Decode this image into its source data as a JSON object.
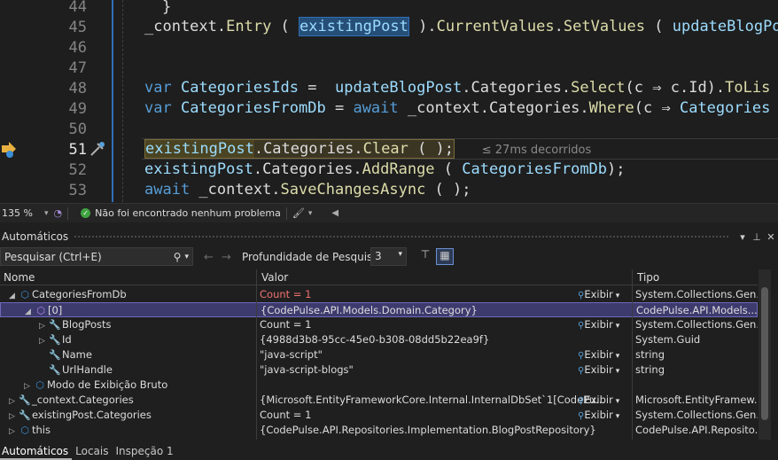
{
  "editor": {
    "lines": [
      {
        "num": "44",
        "text": "}"
      },
      {
        "num": "45",
        "parts": [
          "_context.",
          "Entry",
          " ( ",
          "existingPost",
          " ).",
          "CurrentValues",
          ".",
          "SetValues",
          " ( ",
          "updateBlogPo"
        ]
      },
      {
        "num": "46"
      },
      {
        "num": "47"
      },
      {
        "num": "48",
        "parts": [
          "var",
          " ",
          "CategoriesIds",
          " =  ",
          "updateBlogPost",
          ".Categories.",
          "Select",
          "(c ",
          "⇒",
          " c.Id).",
          "ToLis"
        ]
      },
      {
        "num": "49",
        "parts": [
          "var",
          " ",
          "CategoriesFromDb",
          " = ",
          "await",
          " _context.Categories.",
          "Where",
          "(c ",
          "⇒",
          " Categories"
        ]
      },
      {
        "num": "50"
      },
      {
        "num": "51",
        "parts": [
          "existingPost",
          ".Categories.",
          "Clear",
          " ( );"
        ],
        "elapsed": "≤ 27ms decorridos"
      },
      {
        "num": "52",
        "parts": [
          "existingPost",
          ".Categories.",
          "AddRange",
          " ( ",
          "CategoriesFromDb",
          ");"
        ]
      },
      {
        "num": "53",
        "parts": [
          "await",
          " _context.",
          "SaveChangesAsync",
          " ( );"
        ]
      }
    ]
  },
  "editor_status": {
    "zoom": "135 %",
    "message": "Não foi encontrado nenhum problema"
  },
  "panel": {
    "title": "Automáticos",
    "search_placeholder": "Pesquisar (Ctrl+E)",
    "depth_label": "Profundidade de Pesquisa:",
    "depth_value": "3",
    "columns": {
      "name": "Nome",
      "value": "Valor",
      "type": "Tipo"
    },
    "view_label": "Exibir",
    "rows": [
      {
        "name": "CategoriesFromDb",
        "value": "Count = 1",
        "type": "System.Collections.Gen...",
        "indent": 0,
        "expander": "◢",
        "icon": "cube",
        "changed": true,
        "viewer": true
      },
      {
        "name": "[0]",
        "value": "{CodePulse.API.Models.Domain.Category}",
        "type": "CodePulse.API.Models....",
        "indent": 1,
        "expander": "◢",
        "icon": "cubep",
        "selected": true,
        "viewer": false
      },
      {
        "name": "BlogPosts",
        "value": "Count = 1",
        "type": "System.Collections.Gen...",
        "indent": 2,
        "expander": "▷",
        "icon": "wrench",
        "viewer": true
      },
      {
        "name": "Id",
        "value": "{4988d3b8-95cc-45e0-b308-08dd5b22ea9f}",
        "type": "System.Guid",
        "indent": 2,
        "expander": "▷",
        "icon": "wrench",
        "viewer": false
      },
      {
        "name": "Name",
        "value": "\"java-script\"",
        "type": "string",
        "indent": 2,
        "expander": "",
        "icon": "wrench",
        "viewer": true
      },
      {
        "name": "UrlHandle",
        "value": "\"java-script-blogs\"",
        "type": "string",
        "indent": 2,
        "expander": "",
        "icon": "wrench",
        "viewer": true
      },
      {
        "name": "Modo de Exibição Bruto",
        "value": "",
        "type": "",
        "indent": 1,
        "expander": "▷",
        "icon": "cube",
        "viewer": false
      },
      {
        "name": "_context.Categories",
        "value": "{Microsoft.EntityFrameworkCore.Internal.InternalDbSet`1[CodePu...",
        "type": "Microsoft.EntityFramew...",
        "indent": 0,
        "expander": "▷",
        "icon": "wrench",
        "viewer": true
      },
      {
        "name": "existingPost.Categories",
        "value": "Count = 1",
        "type": "System.Collections.Gen...",
        "indent": 0,
        "expander": "▷",
        "icon": "wrench",
        "viewer": true
      },
      {
        "name": "this",
        "value": "{CodePulse.API.Repositories.Implementation.BlogPostRepository}",
        "type": "CodePulse.API.Reposito...",
        "indent": 0,
        "expander": "▷",
        "icon": "cube",
        "viewer": false
      }
    ]
  },
  "tabs": [
    {
      "label": "Automáticos",
      "active": true
    },
    {
      "label": "Locais",
      "active": false
    },
    {
      "label": "Inspeção 1",
      "active": false
    }
  ],
  "colors": {
    "accent": "#2f6fb8",
    "selection": "#3d3a6e",
    "changed_value": "#f07070"
  }
}
